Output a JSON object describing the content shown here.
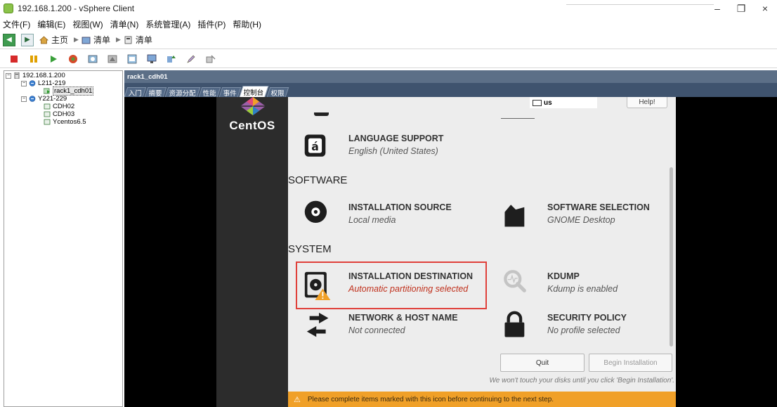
{
  "window": {
    "title": "192.168.1.200 - vSphere Client",
    "minimize": "–",
    "restore": "❐",
    "close": "×"
  },
  "menubar": {
    "items": [
      "文件(F)",
      "编辑(E)",
      "视图(W)",
      "清单(N)",
      "系统管理(A)",
      "插件(P)",
      "帮助(H)"
    ]
  },
  "navbar": {
    "home": "主页",
    "crumb1": "清单",
    "crumb2": "清单"
  },
  "tree": {
    "root": "192.168.1.200",
    "group1": "L211-219",
    "vm_selected": "rack1_cdh01",
    "group2": "Y221-229",
    "vm2": "CDH02",
    "vm3": "CDH03",
    "vm4": "Ycentos6.5"
  },
  "pane": {
    "header": "rack1_cdh01",
    "tabs": [
      "入门",
      "摘要",
      "资源分配",
      "性能",
      "事件",
      "控制台",
      "权限"
    ],
    "active_tab": "控制台"
  },
  "installer": {
    "brand": "CentOS",
    "keyboard": "us",
    "help": "Help!",
    "section_software": "SOFTWARE",
    "section_system": "SYSTEM",
    "language": {
      "title": "LANGUAGE SUPPORT",
      "sub": "English (United States)"
    },
    "source": {
      "title": "INSTALLATION SOURCE",
      "sub": "Local media"
    },
    "software": {
      "title": "SOFTWARE SELECTION",
      "sub": "GNOME Desktop"
    },
    "destination": {
      "title": "INSTALLATION DESTINATION",
      "sub": "Automatic partitioning selected"
    },
    "kdump": {
      "title": "KDUMP",
      "sub": "Kdump is enabled"
    },
    "network": {
      "title": "NETWORK & HOST NAME",
      "sub": "Not connected"
    },
    "security": {
      "title": "SECURITY POLICY",
      "sub": "No profile selected"
    },
    "quit": "Quit",
    "begin": "Begin Installation",
    "note": "We won't touch your disks until you click 'Begin Installation'.",
    "warning": "Please complete items marked with this icon before continuing to the next step.",
    "warning_icon": "⚠"
  },
  "colors": {
    "accent_orange": "#f0a028",
    "warning_red": "#c0311d",
    "header_blue": "#5c6f87"
  }
}
